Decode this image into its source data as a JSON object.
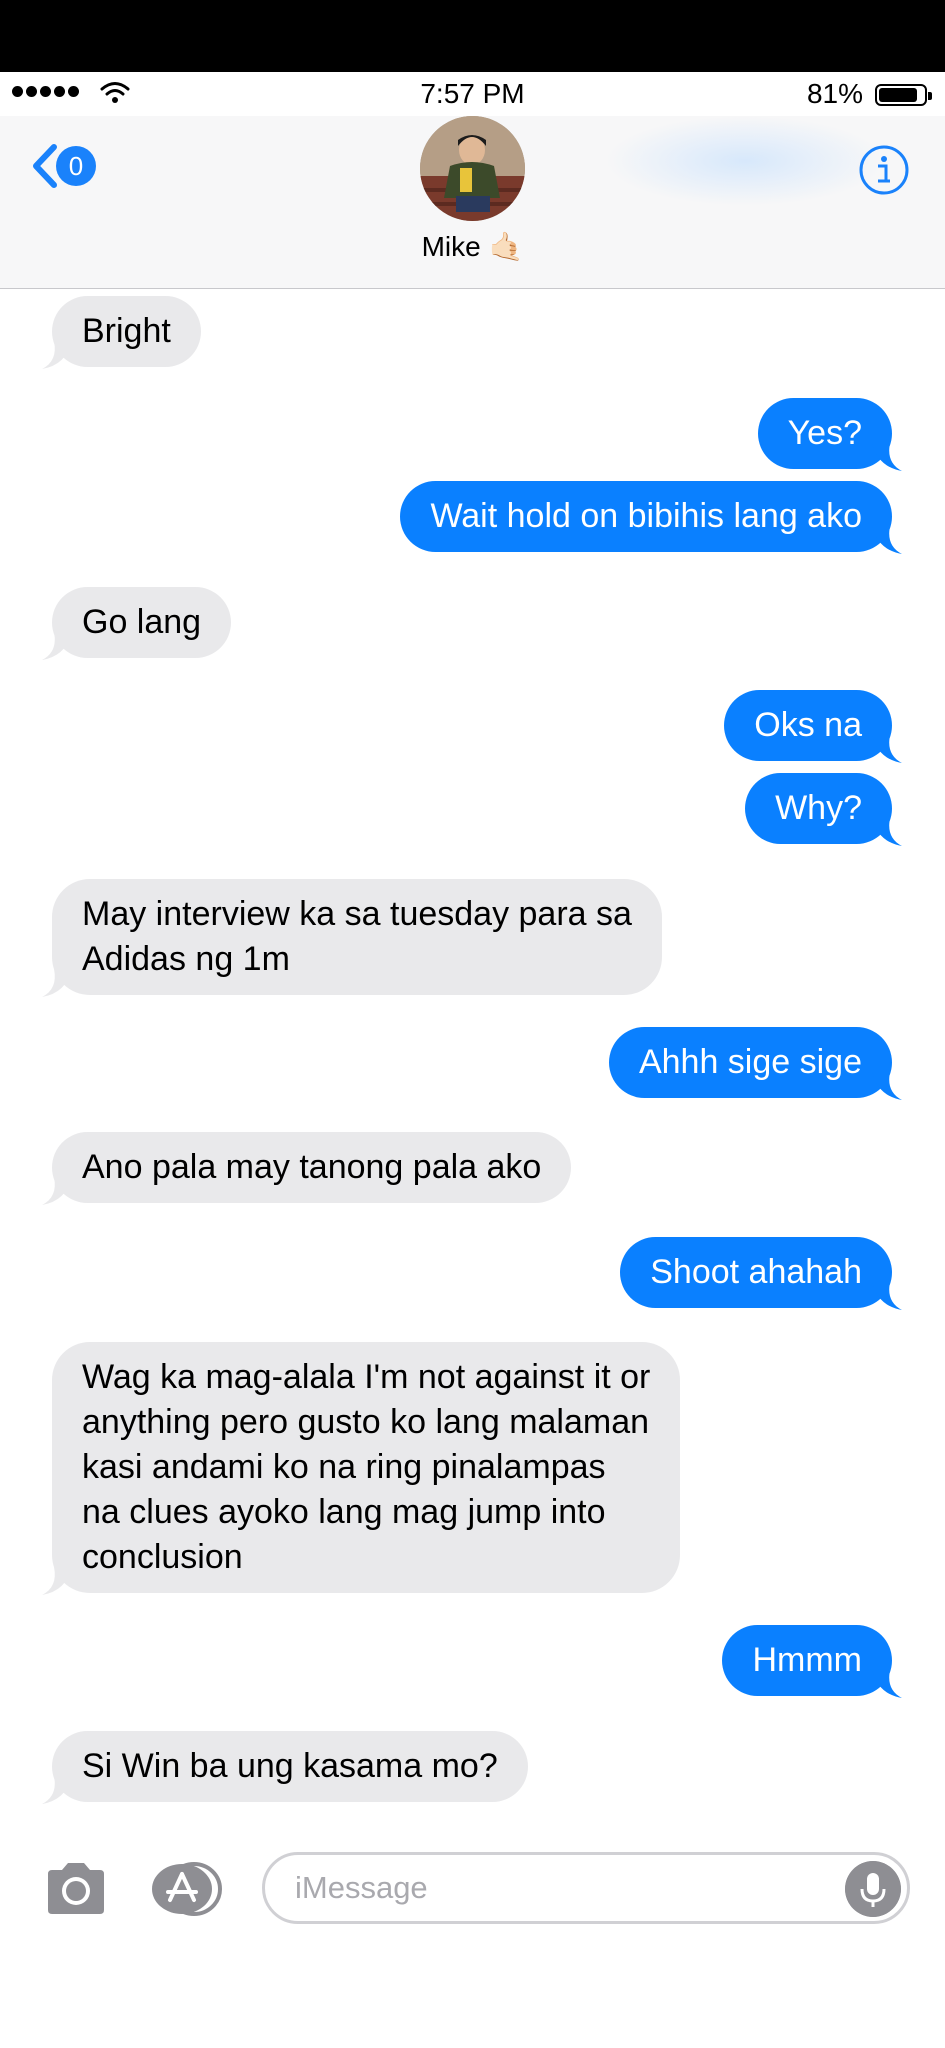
{
  "status_bar": {
    "time": "7:57 PM",
    "battery_percent": "81%",
    "signal_bars": 5,
    "icons": [
      "signal-dots-icon",
      "wifi-icon",
      "battery-icon"
    ]
  },
  "header": {
    "back_badge": "0",
    "contact_name": "Mike 🤙🏻",
    "icons": [
      "back-chevron-icon",
      "info-icon"
    ]
  },
  "messages": [
    {
      "side": "in",
      "text": "Bright"
    },
    {
      "side": "out",
      "text": "Yes?"
    },
    {
      "side": "out",
      "text": "Wait hold on bibihis lang ako"
    },
    {
      "side": "in",
      "text": "Go lang"
    },
    {
      "side": "out",
      "text": "Oks na"
    },
    {
      "side": "out",
      "text": "Why?"
    },
    {
      "side": "in",
      "lines": [
        "May interview ka sa tuesday para sa",
        "Adidas ng 1m"
      ]
    },
    {
      "side": "out",
      "text": "Ahhh sige sige"
    },
    {
      "side": "in",
      "text": "Ano pala may tanong pala ako"
    },
    {
      "side": "out",
      "text": "Shoot ahahah"
    },
    {
      "side": "in",
      "lines": [
        "Wag ka mag-alala I'm not against it or",
        "anything pero gusto ko lang malaman",
        "kasi andami ko na ring pinalampas",
        "na clues ayoko lang mag jump into",
        "conclusion"
      ]
    },
    {
      "side": "out",
      "text": "Hmmm"
    },
    {
      "side": "in",
      "text": "Si Win ba ung kasama mo?"
    }
  ],
  "composer": {
    "placeholder": "iMessage",
    "value": "",
    "icons": [
      "camera-icon",
      "app-store-icon",
      "microphone-icon"
    ]
  },
  "colors": {
    "outgoing_bubble": "#0a80ff",
    "incoming_bubble": "#e9e9eb",
    "accent": "#1a82fb"
  }
}
